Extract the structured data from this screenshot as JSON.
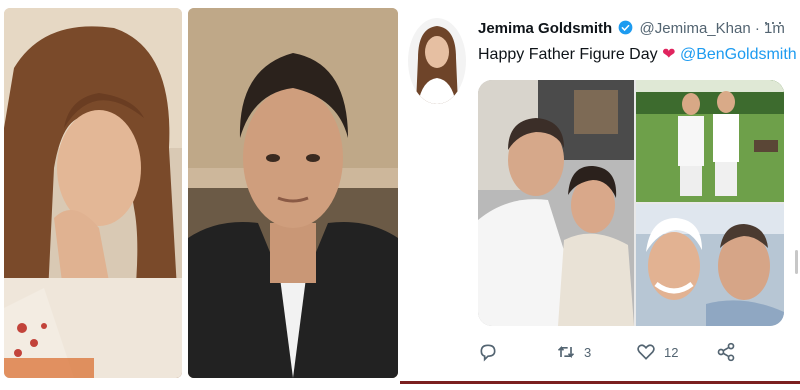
{
  "tweet": {
    "name": "Jemima Goldsmith",
    "handle": "@Jemima_Khan",
    "separator": "·",
    "time": "1m",
    "more": "···",
    "text": "Happy Father Figure Day",
    "heart": "❤",
    "mention": "@BenGoldsmith",
    "counts": {
      "retweets": "3",
      "likes": "12"
    }
  },
  "icons": {
    "verified": "verified-badge-icon",
    "reply": "reply-icon",
    "retweet": "retweet-icon",
    "like": "heart-icon",
    "share": "share-icon"
  },
  "colors": {
    "accent": "#1d9bf0",
    "heart": "#e0245e",
    "muted": "#536471",
    "bottom_rule": "#7a1f1f"
  }
}
